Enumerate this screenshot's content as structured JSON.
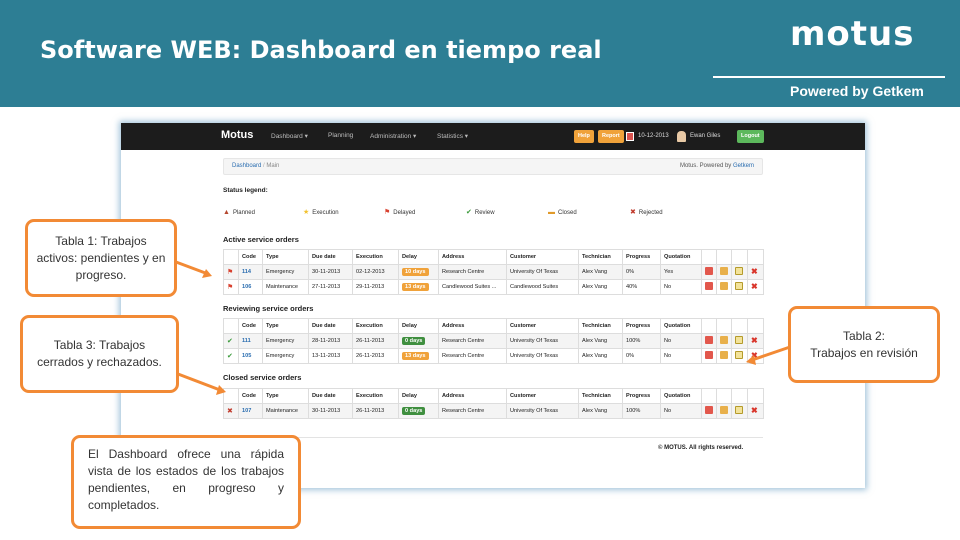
{
  "slide": {
    "title": "Software WEB: Dashboard en tiempo real",
    "logo_text": "motus",
    "powered_by": "Powered by Getkem"
  },
  "app": {
    "brand": "Motus",
    "nav": [
      "Dashboard ▾",
      "Planning",
      "Administration ▾",
      "Statistics ▾"
    ],
    "help_label": "Help",
    "report_label": "Report",
    "date": "10-12-2013",
    "user": "Ewan Giles",
    "logout_label": "Logout",
    "breadcrumb": {
      "home": "Dashboard",
      "sep": "/",
      "current": "Main"
    },
    "powered_text": "Motus. Powered by ",
    "powered_link": "Getkem",
    "legend_title": "Status legend:",
    "legend": [
      {
        "label": "Planned",
        "icon": "planned-icon"
      },
      {
        "label": "Execution",
        "icon": "star-icon"
      },
      {
        "label": "Delayed",
        "icon": "flag-icon"
      },
      {
        "label": "Review",
        "icon": "check-icon"
      },
      {
        "label": "Closed",
        "icon": "closed-icon"
      },
      {
        "label": "Rejected",
        "icon": "rejected-icon"
      }
    ],
    "columns": [
      "",
      "Code",
      "Type",
      "Due date",
      "Execution",
      "Delay",
      "Address",
      "Customer",
      "Technician",
      "Progress",
      "Quotation",
      "",
      "",
      "",
      ""
    ],
    "sections": [
      {
        "title": "Active service orders",
        "rows": [
          {
            "status": "flag-icon",
            "code": "114",
            "type": "Emergency",
            "due": "30-11-2013",
            "execution": "02-12-2013",
            "delay": "10 days",
            "delay_color": "#f0a23a",
            "address": "Research Centre",
            "customer": "University Of Texas",
            "technician": "Alex Vang",
            "progress": "0%",
            "quotation": "Yes"
          },
          {
            "status": "flag-icon",
            "code": "106",
            "type": "Maintenance",
            "due": "27-11-2013",
            "execution": "29-11-2013",
            "delay": "13 days",
            "delay_color": "#f0a23a",
            "address": "Candlewood Suites ...",
            "customer": "Candlewood Suites",
            "technician": "Alex Vang",
            "progress": "40%",
            "quotation": "No"
          }
        ]
      },
      {
        "title": "Reviewing service orders",
        "rows": [
          {
            "status": "check-icon",
            "code": "111",
            "type": "Emergency",
            "due": "28-11-2013",
            "execution": "26-11-2013",
            "delay": "0 days",
            "delay_color": "#3f8f3f",
            "address": "Research Centre",
            "customer": "University Of Texas",
            "technician": "Alex Vang",
            "progress": "100%",
            "quotation": "No"
          },
          {
            "status": "check-icon",
            "code": "105",
            "type": "Emergency",
            "due": "13-11-2013",
            "execution": "26-11-2013",
            "delay": "13 days",
            "delay_color": "#f0a23a",
            "address": "Research Centre",
            "customer": "University Of Texas",
            "technician": "Alex Vang",
            "progress": "0%",
            "quotation": "No"
          }
        ]
      },
      {
        "title": "Closed service orders",
        "rows": [
          {
            "status": "rejected-icon",
            "code": "107",
            "type": "Maintenance",
            "due": "30-11-2013",
            "execution": "26-11-2013",
            "delay": "0 days",
            "delay_color": "#3f8f3f",
            "address": "Research Centre",
            "customer": "University Of Texas",
            "technician": "Alex Vang",
            "progress": "100%",
            "quotation": "No"
          }
        ]
      }
    ],
    "footer": "© MOTUS. All rights reserved."
  },
  "callouts": {
    "tabla1": "Tabla 1:  Trabajos activos: pendientes y en progreso.",
    "tabla2_line1": "Tabla 2:",
    "tabla2_line2": "Trabajos en revisión",
    "tabla3": "Tabla 3: Trabajos cerrados y rechazados.",
    "dashboard": "El Dashboard ofrece una rápida vista de los estados de los trabajos pendientes, en progreso y completados."
  },
  "colors": {
    "header": "#2d7e94",
    "accent": "#f28a35"
  }
}
